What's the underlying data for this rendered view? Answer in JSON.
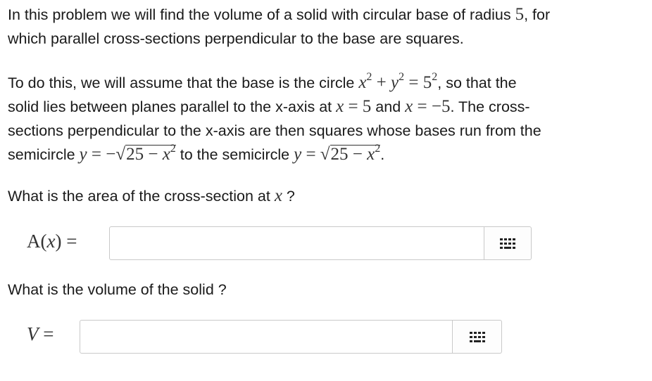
{
  "intro": {
    "s1": "In this problem we will find the volume of a solid with circular base of radius ",
    "radius": "5",
    "s2": ", for",
    "s3": "which parallel cross-sections perpendicular to the base are squares."
  },
  "setup": {
    "s1": "To do this, we will assume that the base is the circle ",
    "eq_circle_x": "x",
    "eq_circle_exp": "2",
    "eq_circle_plus": " + ",
    "eq_circle_y": "y",
    "eq_circle_exp2": "2",
    "eq_circle_eq": " = 5",
    "eq_circle_exp3": "2",
    "s2": ", so that the",
    "s3": "solid lies between planes parallel to the x-axis at ",
    "plane1_var": "x",
    "plane1_val": " = 5",
    "s4": " and ",
    "plane2_var": "x",
    "plane2_val": " = −5",
    "s5": ". The cross-",
    "s6": "sections perpendicular to the x-axis are then squares whose bases run from the",
    "s7": "semicircle ",
    "semi1_var": "y",
    "semi1_eq": " = −√",
    "semi1_rad": "25 − ",
    "semi1_rad_var": "x",
    "semi1_rad_exp": "2",
    "s8": " to the semicircle ",
    "semi2_var": "y",
    "semi2_eq": " = √",
    "semi2_rad": "25 − ",
    "semi2_rad_var": "x",
    "semi2_rad_exp": "2",
    "s9": "."
  },
  "question1": {
    "text": "What is the area of the cross-section at ",
    "var": "x",
    "end": " ?",
    "label_fn": "A(",
    "label_var": "x",
    "label_end": ") ="
  },
  "question2": {
    "text": "What is the volume of the solid ?",
    "label_var": "V",
    "label_end": " ="
  },
  "icons": {
    "keypad": "math-keypad-icon"
  }
}
